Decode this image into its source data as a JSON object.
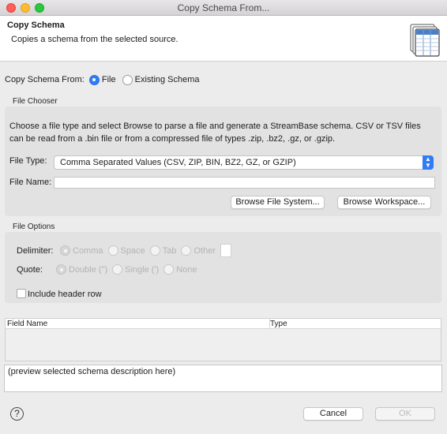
{
  "window": {
    "title": "Copy Schema From..."
  },
  "banner": {
    "title": "Copy Schema",
    "description": "Copies a schema from the selected source.",
    "icon": "schema-table-icon"
  },
  "source": {
    "label": "Copy Schema From:",
    "options": [
      {
        "label": "File",
        "selected": true
      },
      {
        "label": "Existing Schema",
        "selected": false
      }
    ]
  },
  "file_chooser": {
    "group_label": "File Chooser",
    "instructions": "Choose a file type and select Browse to parse a file and generate a StreamBase schema. CSV or TSV files can be read from a .bin file or from a compressed file of types .zip, .bz2, .gz, or .gzip.",
    "file_type_label": "File Type:",
    "file_type_value": "Comma Separated Values (CSV, ZIP, BIN, BZ2, GZ, or GZIP)",
    "file_name_label": "File Name:",
    "file_name_value": "",
    "browse_fs_label": "Browse File System...",
    "browse_ws_label": "Browse Workspace..."
  },
  "file_options": {
    "group_label": "File Options",
    "delimiter_label": "Delimiter:",
    "delimiters": [
      {
        "label": "Comma",
        "selected": true
      },
      {
        "label": "Space",
        "selected": false
      },
      {
        "label": "Tab",
        "selected": false
      },
      {
        "label": "Other",
        "selected": false
      }
    ],
    "quote_label": "Quote:",
    "quotes": [
      {
        "label": "Double (\")",
        "selected": true
      },
      {
        "label": "Single (')",
        "selected": false
      },
      {
        "label": "None",
        "selected": false
      }
    ],
    "header_row_label": "Include header row",
    "header_row_checked": false
  },
  "fields_table": {
    "columns": [
      "Field Name",
      "Type"
    ],
    "rows": []
  },
  "preview": {
    "text": "(preview selected schema description here)"
  },
  "footer": {
    "cancel_label": "Cancel",
    "ok_label": "OK",
    "help_icon": "help-icon"
  },
  "colors": {
    "accent": "#2f7cf6",
    "close": "#fe5f57",
    "minimize": "#febc2e",
    "maximize": "#28c840"
  }
}
